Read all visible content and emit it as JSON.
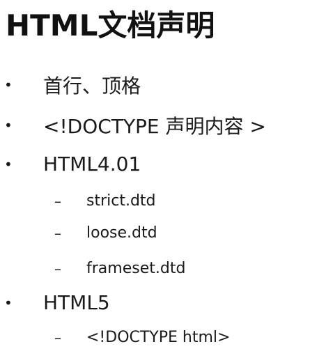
{
  "slide": {
    "title": "HTML文档声明",
    "bullets": [
      {
        "marker": "•",
        "text": "首行、顶格"
      },
      {
        "marker": "•",
        "text": "<!DOCTYPE 声明内容 >"
      },
      {
        "marker": "•",
        "text": "HTML4.01"
      },
      {
        "marker": "–",
        "text": "strict.dtd"
      },
      {
        "marker": "–",
        "text": "loose.dtd"
      },
      {
        "marker": "–",
        "text": "frameset.dtd"
      },
      {
        "marker": "•",
        "text": "HTML5"
      },
      {
        "marker": "–",
        "text": "<!DOCTYPE html>"
      }
    ]
  }
}
